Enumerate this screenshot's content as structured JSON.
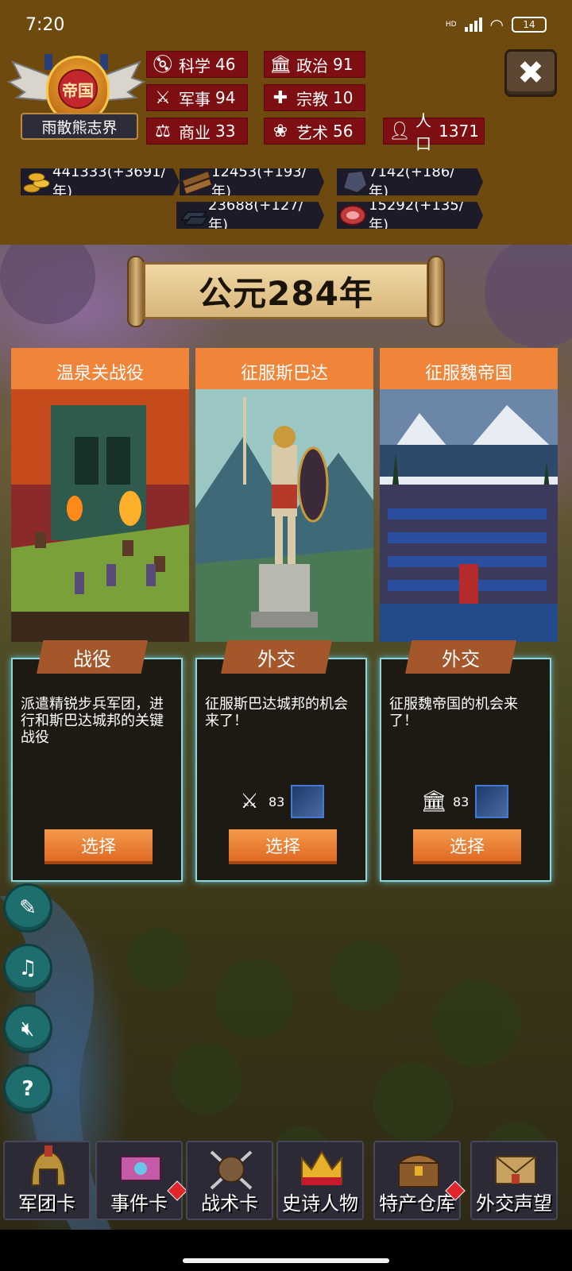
{
  "status_bar": {
    "time": "7:20",
    "hd_label": "HD",
    "battery": "14"
  },
  "empire": {
    "type": "帝国",
    "name": "雨散熊志界"
  },
  "stats": {
    "science": {
      "label": "科学",
      "value": "46"
    },
    "politics": {
      "label": "政治",
      "value": "91"
    },
    "military": {
      "label": "军事",
      "value": "94"
    },
    "religion": {
      "label": "宗教",
      "value": "10"
    },
    "commerce": {
      "label": "商业",
      "value": "33"
    },
    "art": {
      "label": "艺术",
      "value": "56"
    },
    "population": {
      "label": "人口",
      "value": "1371"
    }
  },
  "resources": {
    "gold": "441333(+3691/年)",
    "wood": "12453(+193/年)",
    "stone": "7142(+186/年)",
    "iron": "23688(+127/年)",
    "food": "15292(+135/年)"
  },
  "year": "公元284年",
  "cards": [
    {
      "title": "温泉关战役",
      "tag": "战役",
      "description": "派遣精锐步兵军团，进行和斯巴达城邦的关键战役",
      "button": "选择"
    },
    {
      "title": "征服斯巴达",
      "tag": "外交",
      "description": "征服斯巴达城邦的机会来了！",
      "req_value": "83",
      "req_icon": "military-icon",
      "button": "选择"
    },
    {
      "title": "征服魏帝国",
      "tag": "外交",
      "description": "征服魏帝国的机会来了！",
      "req_value": "83",
      "req_icon": "politics-icon",
      "button": "选择"
    }
  ],
  "nav": [
    {
      "label": "军团卡",
      "icon": "helmet-icon"
    },
    {
      "label": "事件卡",
      "icon": "scroll-icon"
    },
    {
      "label": "战术卡",
      "icon": "shield-swords-icon"
    },
    {
      "label": "史诗人物",
      "icon": "crown-icon"
    },
    {
      "label": "特产仓库",
      "icon": "chest-icon"
    },
    {
      "label": "外交声望",
      "icon": "envelope-icon"
    }
  ],
  "colors": {
    "header_bg": "#6f4a0f",
    "stat_bg": "#7d0f12",
    "card_orange": "#f0853a",
    "card_border": "#8fd6dc",
    "side_button": "#1f6e6e"
  }
}
